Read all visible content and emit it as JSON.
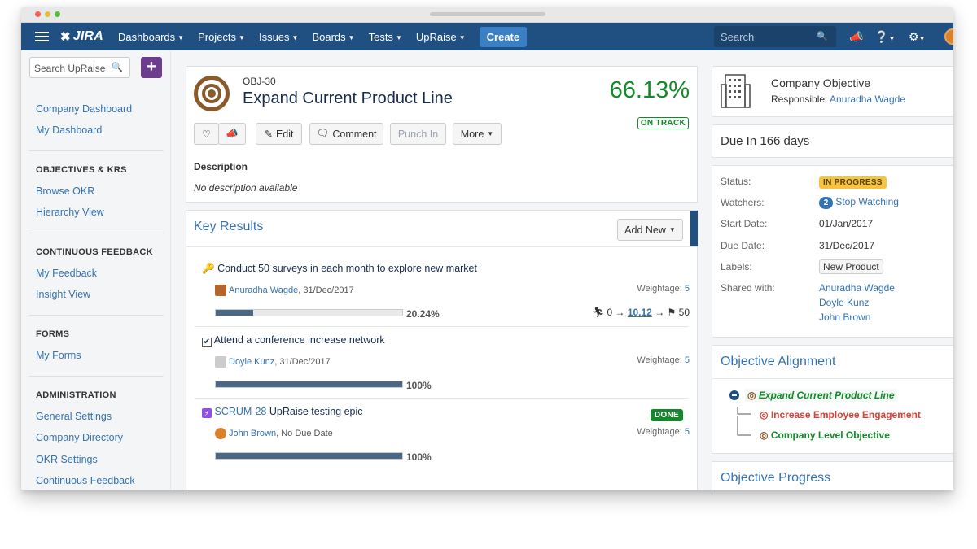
{
  "topnav": {
    "logo": "JIRA",
    "items": [
      "Dashboards",
      "Projects",
      "Issues",
      "Boards",
      "Tests",
      "UpRaise"
    ],
    "create_label": "Create",
    "search_placeholder": "Search"
  },
  "sidebar": {
    "search_placeholder": "Search UpRaise",
    "links_top": [
      "Company Dashboard",
      "My Dashboard"
    ],
    "sections": [
      {
        "heading": "OBJECTIVES & KRS",
        "links": [
          "Browse OKR",
          "Hierarchy View"
        ]
      },
      {
        "heading": "CONTINUOUS FEEDBACK",
        "links": [
          "My Feedback",
          "Insight View"
        ]
      },
      {
        "heading": "FORMS",
        "links": [
          "My Forms"
        ]
      },
      {
        "heading": "ADMINISTRATION",
        "links": [
          "General Settings",
          "Company Directory",
          "OKR Settings",
          "Continuous Feedback"
        ]
      }
    ]
  },
  "objective": {
    "key": "OBJ-30",
    "title": "Expand Current Product Line",
    "progress": "66.13%",
    "status_badge": "ON TRACK",
    "actions": {
      "edit": "Edit",
      "comment": "Comment",
      "punch_in": "Punch In",
      "more": "More"
    },
    "description_heading": "Description",
    "description": "No description available"
  },
  "key_results": {
    "title": "Key Results",
    "add_new": "Add New",
    "items": [
      {
        "title": "Conduct 50 surveys in each month to explore new market",
        "owner": "Anuradha Wagde",
        "date": ", 31/Dec/2017",
        "weightage_label": "Weightage:",
        "weightage": "5",
        "progress": 0.2024,
        "progress_label": "20.24%",
        "start": "0",
        "current": "10.12",
        "target": "50"
      },
      {
        "title": "Attend a conference increase network",
        "owner": "Doyle Kunz",
        "date": ", 31/Dec/2017",
        "weightage_label": "Weightage:",
        "weightage": "5",
        "progress": 1.0,
        "progress_label": "100%"
      },
      {
        "key": "SCRUM-28",
        "title": "UpRaise testing epic",
        "owner": "John Brown",
        "date": ", No Due Date",
        "weightage_label": "Weightage:",
        "weightage": "5",
        "progress": 1.0,
        "progress_label": "100%",
        "status": "DONE"
      }
    ]
  },
  "right_panel": {
    "company_objective": "Company Objective",
    "responsible_label": "Responsible:",
    "responsible": "Anuradha Wagde",
    "due_in": "Due In 166 days",
    "details": {
      "status_label": "Status:",
      "status": "IN PROGRESS",
      "watchers_label": "Watchers:",
      "watchers_count": "2",
      "watchers_action": "Stop Watching",
      "start_label": "Start Date:",
      "start": "01/Jan/2017",
      "due_label": "Due Date:",
      "due": "31/Dec/2017",
      "labels_label": "Labels:",
      "label": "New Product",
      "shared_label": "Shared with:",
      "shared": [
        "Anuradha Wagde",
        "Doyle Kunz",
        "John Brown"
      ]
    },
    "alignment_title": "Objective Alignment",
    "alignment": [
      "Expand Current Product Line",
      "Increase Employee Engagement",
      "Company Level Objective"
    ],
    "progress_title": "Objective Progress"
  },
  "colors": {
    "nav": "#205081",
    "link": "#3572b0",
    "success": "#14892c",
    "bar": "#4a6785",
    "objective_icon": "#8b5a2b"
  }
}
